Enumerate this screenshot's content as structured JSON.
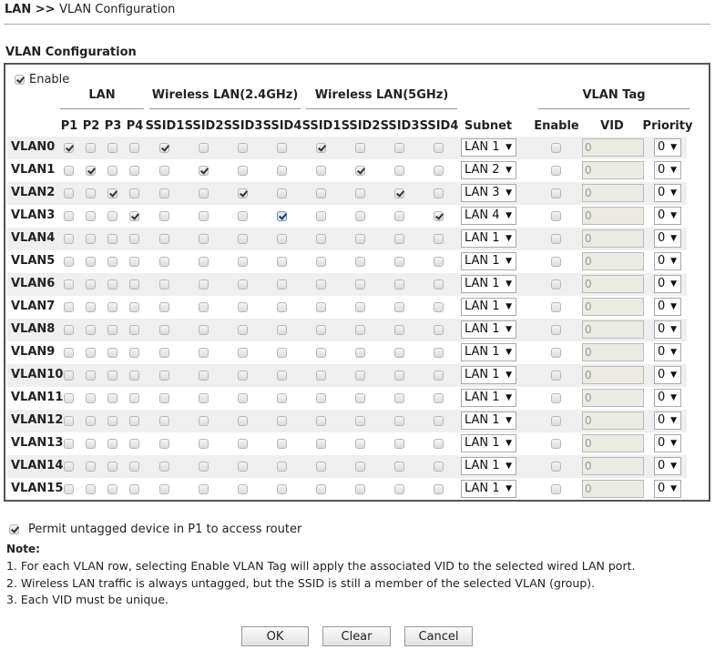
{
  "header": {
    "breadcrumb_prefix": "LAN >> ",
    "breadcrumb_current": "VLAN Configuration"
  },
  "section_title": "VLAN Configuration",
  "enable": {
    "label": "Enable",
    "checked": true
  },
  "groups": {
    "lan": "LAN",
    "wlan24": "Wireless LAN(2.4GHz)",
    "wlan5": "Wireless LAN(5GHz)",
    "vlan_tag": "VLAN Tag"
  },
  "columns": {
    "lan": [
      "P1",
      "P2",
      "P3",
      "P4"
    ],
    "wlan24": [
      "SSID1",
      "SSID2",
      "SSID3",
      "SSID4"
    ],
    "wlan5": [
      "SSID1",
      "SSID2",
      "SSID3",
      "SSID4"
    ],
    "subnet": "Subnet",
    "enable": "Enable",
    "vid": "VID",
    "priority": "Priority"
  },
  "rows": [
    {
      "name": "VLAN0",
      "lan": [
        1,
        0,
        0,
        0
      ],
      "wlan24": [
        1,
        0,
        0,
        0
      ],
      "wlan5": [
        1,
        0,
        0,
        0
      ],
      "subnet": "LAN 1",
      "tag": false,
      "vid": "0",
      "priority": "0"
    },
    {
      "name": "VLAN1",
      "lan": [
        0,
        1,
        0,
        0
      ],
      "wlan24": [
        0,
        1,
        0,
        0
      ],
      "wlan5": [
        0,
        1,
        0,
        0
      ],
      "subnet": "LAN 2",
      "tag": false,
      "vid": "0",
      "priority": "0"
    },
    {
      "name": "VLAN2",
      "lan": [
        0,
        0,
        1,
        0
      ],
      "wlan24": [
        0,
        0,
        1,
        0
      ],
      "wlan5": [
        0,
        0,
        1,
        0
      ],
      "subnet": "LAN 3",
      "tag": false,
      "vid": "0",
      "priority": "0"
    },
    {
      "name": "VLAN3",
      "lan": [
        0,
        0,
        0,
        1
      ],
      "wlan24": [
        0,
        0,
        0,
        1
      ],
      "wlan5": [
        0,
        0,
        0,
        1
      ],
      "subnet": "LAN 4",
      "tag": false,
      "vid": "0",
      "priority": "0"
    },
    {
      "name": "VLAN4",
      "lan": [
        0,
        0,
        0,
        0
      ],
      "wlan24": [
        0,
        0,
        0,
        0
      ],
      "wlan5": [
        0,
        0,
        0,
        0
      ],
      "subnet": "LAN 1",
      "tag": false,
      "vid": "0",
      "priority": "0"
    },
    {
      "name": "VLAN5",
      "lan": [
        0,
        0,
        0,
        0
      ],
      "wlan24": [
        0,
        0,
        0,
        0
      ],
      "wlan5": [
        0,
        0,
        0,
        0
      ],
      "subnet": "LAN 1",
      "tag": false,
      "vid": "0",
      "priority": "0"
    },
    {
      "name": "VLAN6",
      "lan": [
        0,
        0,
        0,
        0
      ],
      "wlan24": [
        0,
        0,
        0,
        0
      ],
      "wlan5": [
        0,
        0,
        0,
        0
      ],
      "subnet": "LAN 1",
      "tag": false,
      "vid": "0",
      "priority": "0"
    },
    {
      "name": "VLAN7",
      "lan": [
        0,
        0,
        0,
        0
      ],
      "wlan24": [
        0,
        0,
        0,
        0
      ],
      "wlan5": [
        0,
        0,
        0,
        0
      ],
      "subnet": "LAN 1",
      "tag": false,
      "vid": "0",
      "priority": "0"
    },
    {
      "name": "VLAN8",
      "lan": [
        0,
        0,
        0,
        0
      ],
      "wlan24": [
        0,
        0,
        0,
        0
      ],
      "wlan5": [
        0,
        0,
        0,
        0
      ],
      "subnet": "LAN 1",
      "tag": false,
      "vid": "0",
      "priority": "0"
    },
    {
      "name": "VLAN9",
      "lan": [
        0,
        0,
        0,
        0
      ],
      "wlan24": [
        0,
        0,
        0,
        0
      ],
      "wlan5": [
        0,
        0,
        0,
        0
      ],
      "subnet": "LAN 1",
      "tag": false,
      "vid": "0",
      "priority": "0"
    },
    {
      "name": "VLAN10",
      "lan": [
        0,
        0,
        0,
        0
      ],
      "wlan24": [
        0,
        0,
        0,
        0
      ],
      "wlan5": [
        0,
        0,
        0,
        0
      ],
      "subnet": "LAN 1",
      "tag": false,
      "vid": "0",
      "priority": "0"
    },
    {
      "name": "VLAN11",
      "lan": [
        0,
        0,
        0,
        0
      ],
      "wlan24": [
        0,
        0,
        0,
        0
      ],
      "wlan5": [
        0,
        0,
        0,
        0
      ],
      "subnet": "LAN 1",
      "tag": false,
      "vid": "0",
      "priority": "0"
    },
    {
      "name": "VLAN12",
      "lan": [
        0,
        0,
        0,
        0
      ],
      "wlan24": [
        0,
        0,
        0,
        0
      ],
      "wlan5": [
        0,
        0,
        0,
        0
      ],
      "subnet": "LAN 1",
      "tag": false,
      "vid": "0",
      "priority": "0"
    },
    {
      "name": "VLAN13",
      "lan": [
        0,
        0,
        0,
        0
      ],
      "wlan24": [
        0,
        0,
        0,
        0
      ],
      "wlan5": [
        0,
        0,
        0,
        0
      ],
      "subnet": "LAN 1",
      "tag": false,
      "vid": "0",
      "priority": "0"
    },
    {
      "name": "VLAN14",
      "lan": [
        0,
        0,
        0,
        0
      ],
      "wlan24": [
        0,
        0,
        0,
        0
      ],
      "wlan5": [
        0,
        0,
        0,
        0
      ],
      "subnet": "LAN 1",
      "tag": false,
      "vid": "0",
      "priority": "0"
    },
    {
      "name": "VLAN15",
      "lan": [
        0,
        0,
        0,
        0
      ],
      "wlan24": [
        0,
        0,
        0,
        0
      ],
      "wlan5": [
        0,
        0,
        0,
        0
      ],
      "subnet": "LAN 1",
      "tag": false,
      "vid": "0",
      "priority": "0"
    }
  ],
  "permit": {
    "label": "Permit untagged device in P1 to access router",
    "checked": true
  },
  "note": {
    "title": "Note:",
    "lines": [
      "1. For each VLAN row, selecting Enable VLAN Tag will apply the associated VID to the selected wired LAN port.",
      "2. Wireless LAN traffic is always untagged, but the SSID is still a member of the selected VLAN (group).",
      "3. Each VID must be unique."
    ]
  },
  "buttons": {
    "ok": "OK",
    "clear": "Clear",
    "cancel": "Cancel"
  }
}
